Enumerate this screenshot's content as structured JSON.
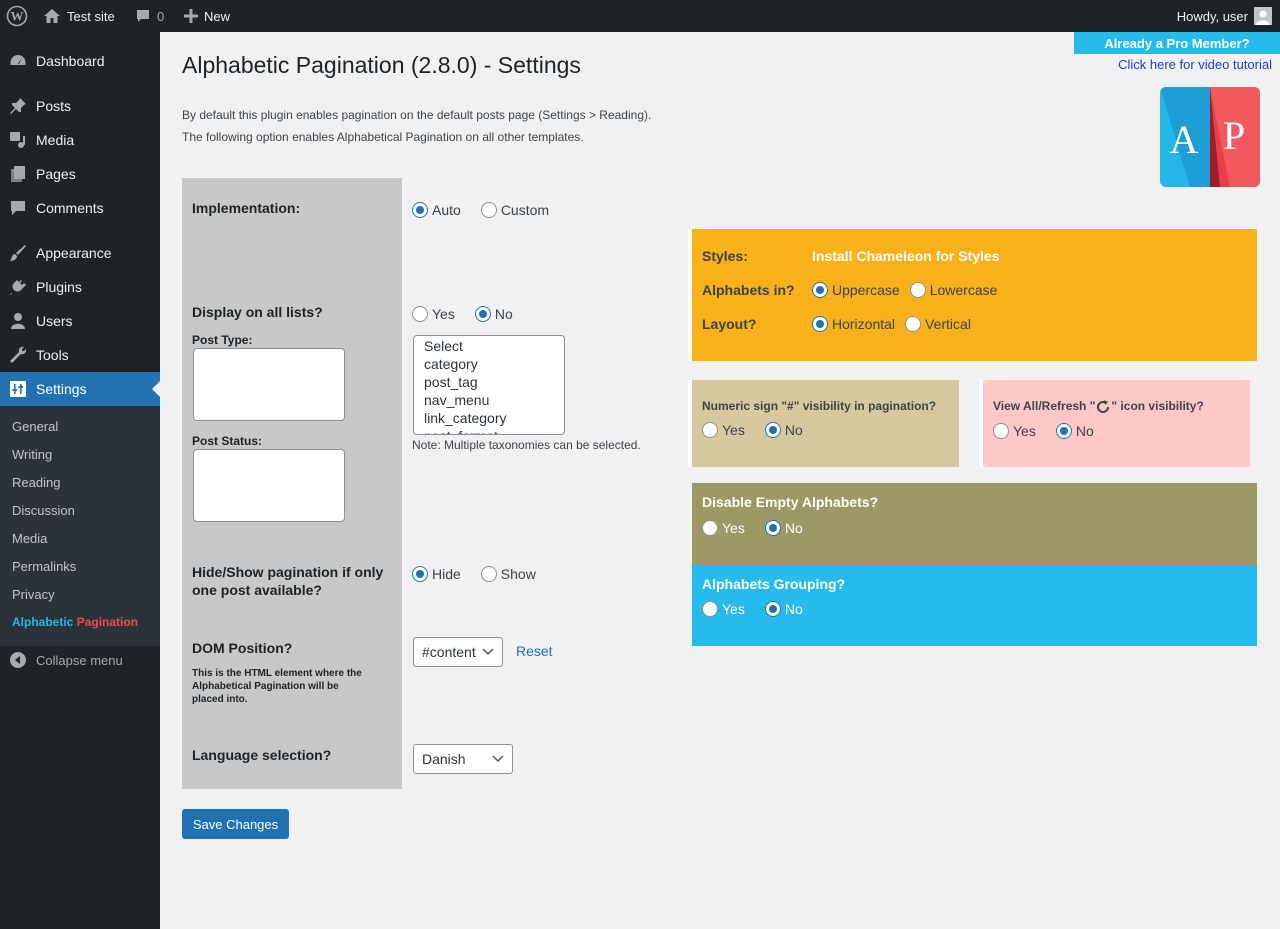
{
  "adminbar": {
    "site_name": "Test site",
    "comments_count": "0",
    "new_label": "New",
    "howdy": "Howdy, user"
  },
  "sidebar": {
    "items": [
      {
        "label": "Dashboard",
        "icon": "dashboard-icon"
      },
      {
        "label": "Posts",
        "icon": "pin-icon"
      },
      {
        "label": "Media",
        "icon": "media-icon"
      },
      {
        "label": "Pages",
        "icon": "pages-icon"
      },
      {
        "label": "Comments",
        "icon": "comment-icon"
      },
      {
        "label": "Appearance",
        "icon": "brush-icon"
      },
      {
        "label": "Plugins",
        "icon": "plugin-icon"
      },
      {
        "label": "Users",
        "icon": "user-icon"
      },
      {
        "label": "Tools",
        "icon": "wrench-icon"
      },
      {
        "label": "Settings",
        "icon": "settings-icon"
      }
    ],
    "submenu": [
      "General",
      "Writing",
      "Reading",
      "Discussion",
      "Media",
      "Permalinks",
      "Privacy"
    ],
    "plugin_link_part1": "Alphabetic",
    "plugin_link_part2": "Pagination",
    "collapse": "Collapse menu"
  },
  "header": {
    "title": "Alphabetic Pagination (2.8.0) - Settings",
    "intro_line1": "By default this plugin enables pagination on the default posts page (Settings > Reading).",
    "intro_line2": "The following option enables Alphabetical Pagination on all other templates.",
    "pro_member": "Already a Pro Member?",
    "video_tutorial": "Click here for video tutorial",
    "logo_letters": [
      "A",
      "P"
    ]
  },
  "form": {
    "implementation": {
      "label": "Implementation:",
      "options": [
        "Auto",
        "Custom"
      ],
      "selected": "Auto"
    },
    "display_all_lists": {
      "label": "Display on all lists?",
      "options": [
        "Yes",
        "No"
      ],
      "selected": "No"
    },
    "post_type_label": "Post Type:",
    "post_status_label": "Post Status:",
    "taxonomies": [
      "Select",
      "category",
      "post_tag",
      "nav_menu",
      "link_category",
      "post_format"
    ],
    "taxonomy_note": "Note: Multiple taxonomies can be selected.",
    "hide_show": {
      "label": "Hide/Show pagination if only one post available?",
      "options": [
        "Hide",
        "Show"
      ],
      "selected": "Hide"
    },
    "dom_position": {
      "label": "DOM Position?",
      "note": "This is the HTML element where the Alphabetical Pagination will be placed into.",
      "value": "#content",
      "reset": "Reset"
    },
    "language": {
      "label": "Language selection?",
      "value": "Danish"
    },
    "save": "Save Changes"
  },
  "panels": {
    "styles": {
      "label": "Styles:",
      "value": "Install Chameleon for Styles"
    },
    "alphabets_in": {
      "label": "Alphabets in?",
      "options": [
        "Uppercase",
        "Lowercase"
      ],
      "selected": "Uppercase"
    },
    "layout": {
      "label": "Layout?",
      "options": [
        "Horizontal",
        "Vertical"
      ],
      "selected": "Horizontal"
    },
    "numeric_sign": {
      "label": "Numeric sign \"#\" visibility in pagination?",
      "options": [
        "Yes",
        "No"
      ],
      "selected": "No"
    },
    "view_all_prefix": "View All/Refresh \"",
    "view_all_suffix": "\" icon visibility?",
    "view_all": {
      "options": [
        "Yes",
        "No"
      ],
      "selected": "No"
    },
    "disable_empty": {
      "label": "Disable Empty Alphabets?",
      "options": [
        "Yes",
        "No"
      ],
      "selected": "No"
    },
    "grouping": {
      "label": "Alphabets Grouping?",
      "options": [
        "Yes",
        "No"
      ],
      "selected": "No"
    }
  },
  "colors": {
    "admin_dark": "#1d2327",
    "accent": "#2271b1",
    "orange": "#f8b11b",
    "tan": "#d6c9a0",
    "pink": "#ffc8c8",
    "olive": "#9c9966",
    "cyan": "#27bbec"
  }
}
